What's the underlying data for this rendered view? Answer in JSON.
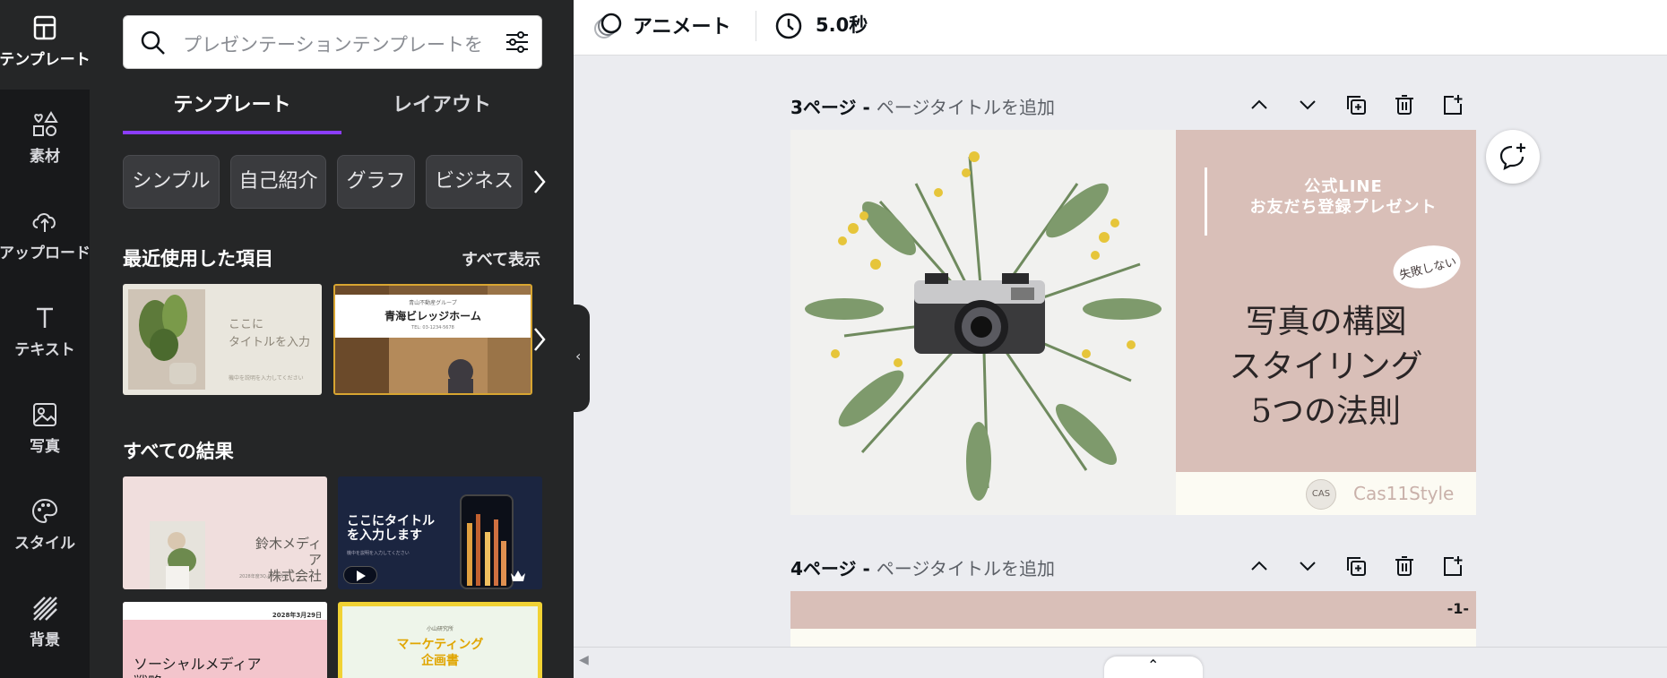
{
  "rail": {
    "items": [
      {
        "label": "テンプレート",
        "icon": "templates-icon"
      },
      {
        "label": "素材",
        "icon": "elements-icon"
      },
      {
        "label": "アップロード",
        "icon": "upload-icon"
      },
      {
        "label": "テキスト",
        "icon": "text-icon"
      },
      {
        "label": "写真",
        "icon": "photo-icon"
      },
      {
        "label": "スタイル",
        "icon": "palette-icon"
      },
      {
        "label": "背景",
        "icon": "background-icon"
      }
    ]
  },
  "panel": {
    "search_placeholder": "プレゼンテーションテンプレートを",
    "tabs": [
      "テンプレート",
      "レイアウト"
    ],
    "chips": [
      "シンプル",
      "自己紹介",
      "グラフ",
      "ビジネス"
    ],
    "recent_title": "最近使用した項目",
    "see_all": "すべて表示",
    "all_results_title": "すべての結果",
    "recent": [
      {
        "line1": "ここに",
        "line2": "タイトルを入力",
        "note": "機中を説明を入力してください"
      },
      {
        "kicker": "青山不動産グループ",
        "title": "青海ビレッジホーム",
        "sub": "TEL: 03-1234-5678"
      }
    ],
    "results": [
      {
        "title1": "鈴木メディア",
        "title2": "株式会社",
        "note": "2028年度3Qより部改善"
      },
      {
        "title1": "ここにタイトル",
        "title2": "を入力します",
        "note": "機中を説明を入力してください"
      },
      {
        "date": "2028年3月29日",
        "title1": "ソーシャルメディア",
        "title2": "戦略"
      },
      {
        "kicker": "小山研究所",
        "title1": "マーケティング",
        "title2": "企画書"
      }
    ]
  },
  "topbar": {
    "animate_label": "アニメート",
    "duration": "5.0秒"
  },
  "pages": [
    {
      "number_label": "3ページ - ",
      "title_placeholder": "ページタイトルを追加"
    },
    {
      "number_label": "4ページ - ",
      "title_placeholder": "ページタイトルを追加"
    }
  ],
  "slide3": {
    "line_note_1": "公式LINE",
    "line_note_2": "お友だち登録プレゼント",
    "bubble": "失敗しない",
    "title1": "写真の構図",
    "title2": "スタイリング",
    "title3": "5つの法則",
    "logo_text": "CAS",
    "brand": "Cas11Style"
  },
  "slide4": {
    "page_no": "-1-"
  },
  "colors": {
    "accent": "#8b3dff",
    "panel_bg": "#252627",
    "rail_bg": "#18191b",
    "slide_pink": "#d9bfb8",
    "slide_cream": "#fcfbf3"
  }
}
